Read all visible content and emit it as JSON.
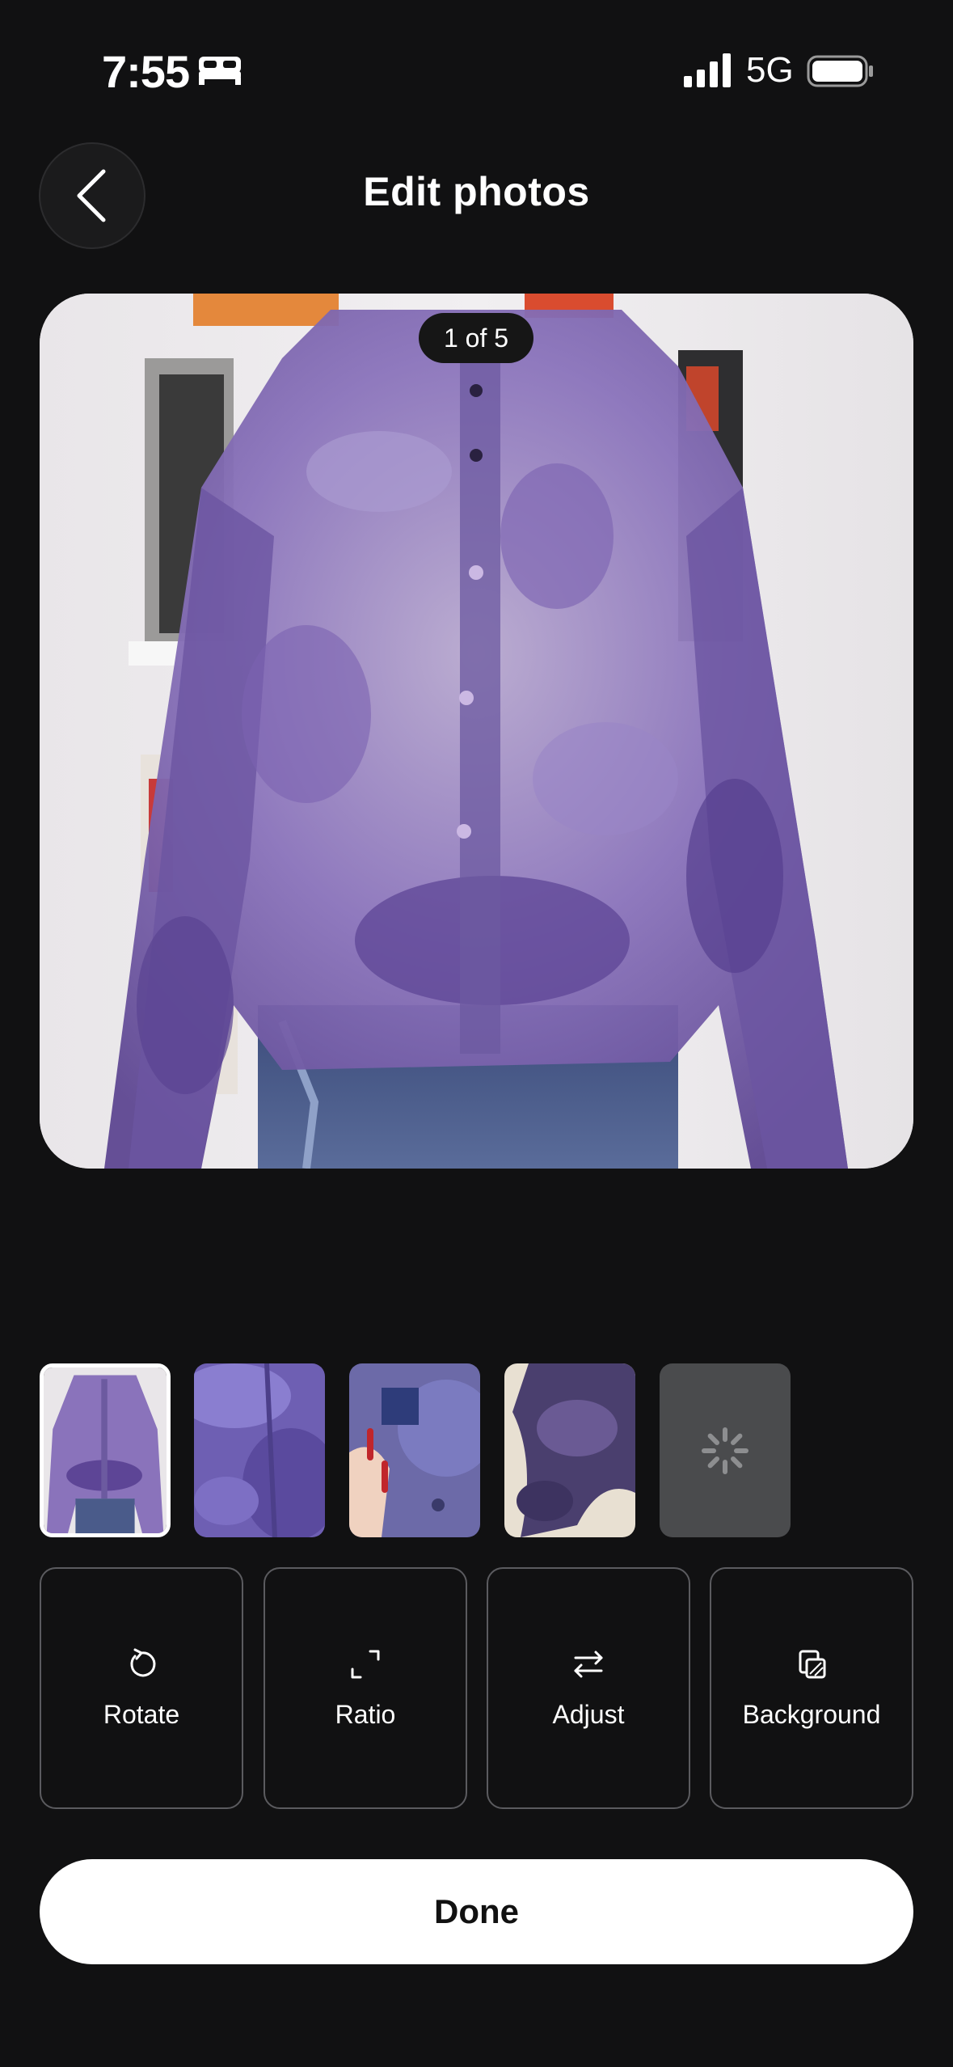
{
  "status_bar": {
    "time": "7:55",
    "network": "5G",
    "icons": [
      "bed-icon",
      "signal-icon",
      "battery-icon"
    ]
  },
  "header": {
    "title": "Edit photos",
    "back_icon": "chevron-left-icon"
  },
  "photo": {
    "counter": "1 of 5",
    "subject": "purple floral sheer button-up blouse over jeans"
  },
  "thumbnails": [
    {
      "id": "photo-1",
      "selected": true
    },
    {
      "id": "photo-2",
      "selected": false
    },
    {
      "id": "photo-3",
      "selected": false
    },
    {
      "id": "photo-4",
      "selected": false
    },
    {
      "id": "photo-5",
      "selected": false,
      "loading": true
    }
  ],
  "tools": [
    {
      "label": "Rotate",
      "icon": "rotate-icon"
    },
    {
      "label": "Ratio",
      "icon": "ratio-icon"
    },
    {
      "label": "Adjust",
      "icon": "adjust-icon"
    },
    {
      "label": "Background",
      "icon": "background-icon"
    }
  ],
  "done_label": "Done",
  "colors": {
    "background": "#111112",
    "accent_purple": "#7a62b0",
    "button": "#ffffff"
  }
}
